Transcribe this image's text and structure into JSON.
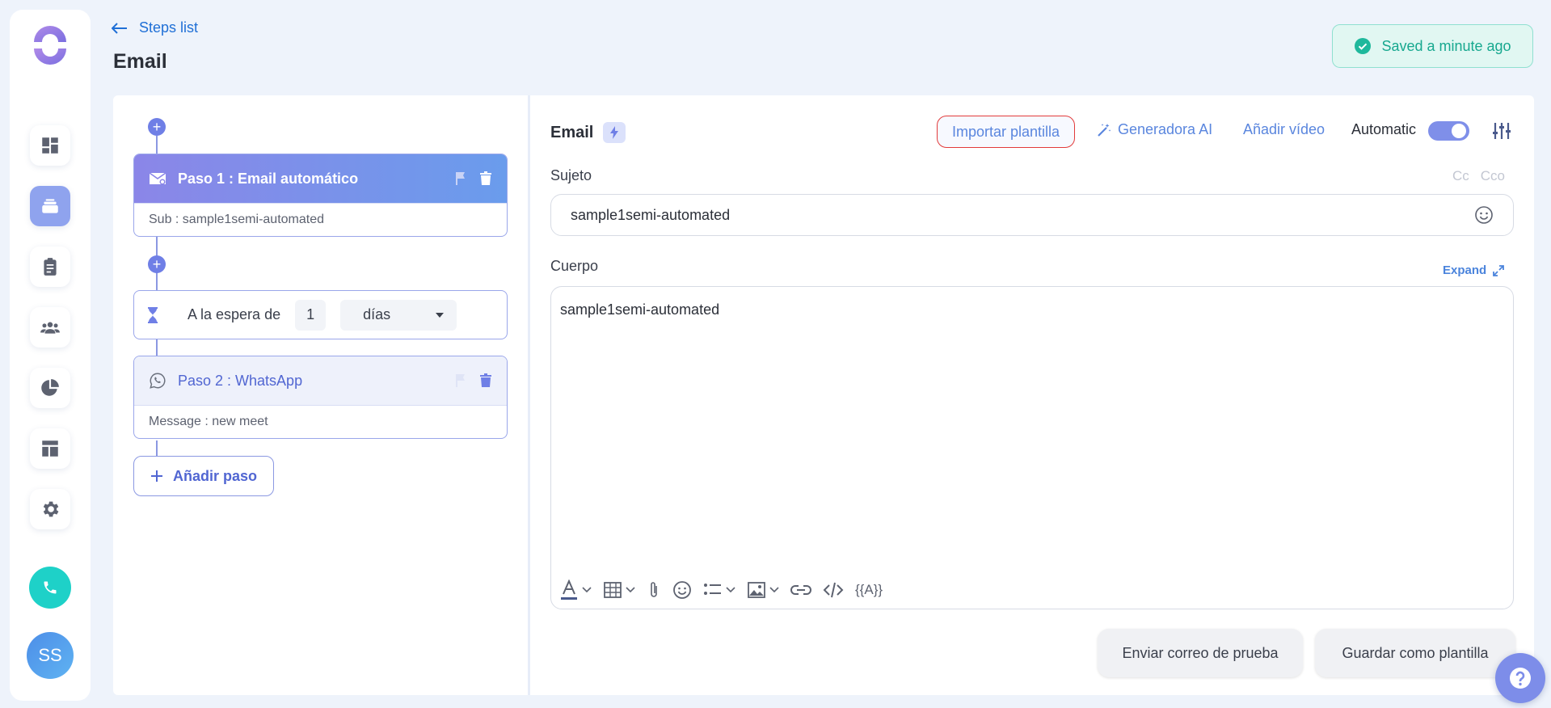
{
  "header": {
    "back_label": "Steps list",
    "title": "Email",
    "saved_status": "Saved a minute ago"
  },
  "sidebar": {
    "items": [
      {
        "icon": "dashboard-icon"
      },
      {
        "icon": "sequences-icon",
        "active": true
      },
      {
        "icon": "clipboard-icon"
      },
      {
        "icon": "users-icon"
      },
      {
        "icon": "pie-chart-icon"
      },
      {
        "icon": "layout-icon"
      },
      {
        "icon": "gear-icon"
      }
    ],
    "avatar_initials": "SS"
  },
  "steps": {
    "step1": {
      "title": "Paso 1 : Email automático",
      "sub": "Sub : sample1semi-automated"
    },
    "wait": {
      "label": "A la espera de",
      "value": "1",
      "unit": "días"
    },
    "step2": {
      "title": "Paso 2 : WhatsApp",
      "sub": "Message : new meet"
    },
    "add_label": "Añadir paso"
  },
  "editor": {
    "title": "Email",
    "import_label": "Importar plantilla",
    "ai_label": "Generadora AI",
    "video_label": "Añadir vídeo",
    "automatic_label": "Automatic",
    "automatic_on": true,
    "subject_label": "Sujeto",
    "cc_label": "Cc",
    "cco_label": "Cco",
    "subject_value": "sample1semi-automated",
    "body_label": "Cuerpo",
    "expand_label": "Expand",
    "body_text": "sample1semi-automated",
    "template_var_label": "{{A}}",
    "test_button": "Enviar correo de prueba",
    "save_template_button": "Guardar como plantilla"
  },
  "colors": {
    "accent": "#6f7fe6",
    "link": "#5a86de",
    "success": "#17a88f",
    "highlight_border": "#e23b3b"
  }
}
